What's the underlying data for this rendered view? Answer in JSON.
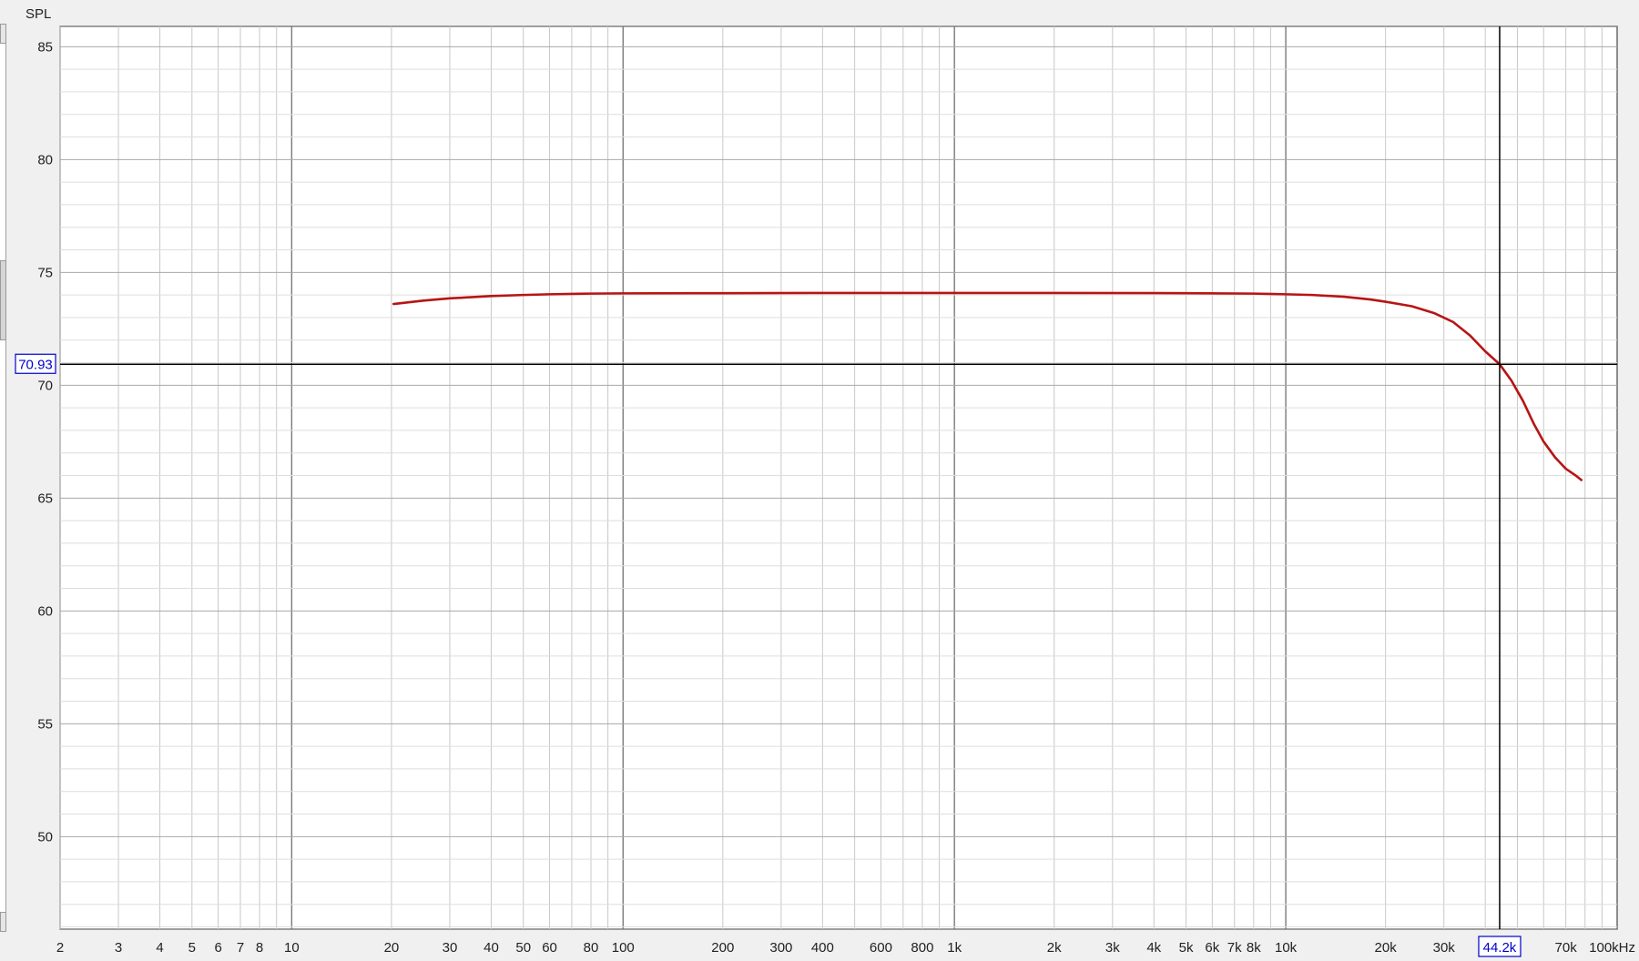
{
  "chart_data": {
    "type": "line",
    "title": "",
    "ylabel": "SPL",
    "xlabel": "",
    "x_scale": "log",
    "xlim": [
      2,
      100000
    ],
    "ylim": [
      45.9,
      85.9
    ],
    "grid": true,
    "legend": "none",
    "x_ticks": [
      {
        "v": 2,
        "label": "2"
      },
      {
        "v": 3,
        "label": "3"
      },
      {
        "v": 4,
        "label": "4"
      },
      {
        "v": 5,
        "label": "5"
      },
      {
        "v": 6,
        "label": "6"
      },
      {
        "v": 7,
        "label": "7"
      },
      {
        "v": 8,
        "label": "8"
      },
      {
        "v": 10,
        "label": "10"
      },
      {
        "v": 20,
        "label": "20"
      },
      {
        "v": 30,
        "label": "30"
      },
      {
        "v": 40,
        "label": "40"
      },
      {
        "v": 50,
        "label": "50"
      },
      {
        "v": 60,
        "label": "60"
      },
      {
        "v": 80,
        "label": "80"
      },
      {
        "v": 100,
        "label": "100"
      },
      {
        "v": 200,
        "label": "200"
      },
      {
        "v": 300,
        "label": "300"
      },
      {
        "v": 400,
        "label": "400"
      },
      {
        "v": 600,
        "label": "600"
      },
      {
        "v": 800,
        "label": "800"
      },
      {
        "v": 1000,
        "label": "1k"
      },
      {
        "v": 2000,
        "label": "2k"
      },
      {
        "v": 3000,
        "label": "3k"
      },
      {
        "v": 4000,
        "label": "4k"
      },
      {
        "v": 5000,
        "label": "5k"
      },
      {
        "v": 6000,
        "label": "6k"
      },
      {
        "v": 7000,
        "label": "7k"
      },
      {
        "v": 8000,
        "label": "8k"
      },
      {
        "v": 10000,
        "label": "10k"
      },
      {
        "v": 20000,
        "label": "20k"
      },
      {
        "v": 30000,
        "label": "30k"
      },
      {
        "v": 70000,
        "label": "70k"
      },
      {
        "v": 100000,
        "label": "100kHz"
      }
    ],
    "y_ticks": [
      {
        "v": 50,
        "label": "50"
      },
      {
        "v": 55,
        "label": "55"
      },
      {
        "v": 60,
        "label": "60"
      },
      {
        "v": 65,
        "label": "65"
      },
      {
        "v": 70,
        "label": "70"
      },
      {
        "v": 75,
        "label": "75"
      },
      {
        "v": 80,
        "label": "80"
      },
      {
        "v": 85,
        "label": "85"
      }
    ],
    "series": [
      {
        "color": "#b81414",
        "points": [
          [
            20.3,
            73.6
          ],
          [
            25,
            73.75
          ],
          [
            30,
            73.85
          ],
          [
            40,
            73.95
          ],
          [
            50,
            74.0
          ],
          [
            60,
            74.03
          ],
          [
            80,
            74.06
          ],
          [
            100,
            74.07
          ],
          [
            200,
            74.08
          ],
          [
            500,
            74.09
          ],
          [
            1000,
            74.09
          ],
          [
            2000,
            74.09
          ],
          [
            5000,
            74.08
          ],
          [
            8000,
            74.06
          ],
          [
            10000,
            74.03
          ],
          [
            12000,
            74.0
          ],
          [
            15000,
            73.92
          ],
          [
            18000,
            73.8
          ],
          [
            20000,
            73.7
          ],
          [
            24000,
            73.5
          ],
          [
            28000,
            73.2
          ],
          [
            32000,
            72.8
          ],
          [
            36000,
            72.2
          ],
          [
            40000,
            71.5
          ],
          [
            44200,
            70.93
          ],
          [
            48000,
            70.2
          ],
          [
            52000,
            69.3
          ],
          [
            56000,
            68.3
          ],
          [
            60000,
            67.5
          ],
          [
            65000,
            66.8
          ],
          [
            70000,
            66.3
          ],
          [
            75000,
            66.0
          ],
          [
            78000,
            65.8
          ]
        ]
      }
    ],
    "cursor": {
      "x": 44200,
      "x_label": "44.2k",
      "y": 70.93,
      "y_label": "70.93",
      "color": "#0000cc"
    }
  }
}
